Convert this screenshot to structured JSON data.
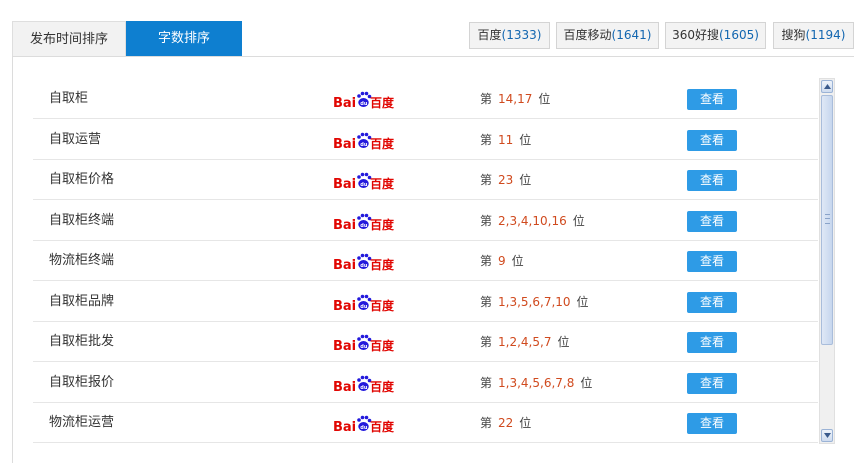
{
  "tabs": {
    "time": "发布时间排序",
    "count": "字数排序"
  },
  "engines": [
    {
      "name": "百度",
      "count": "(1333)"
    },
    {
      "name": "百度移动",
      "count": "(1641)"
    },
    {
      "name": "360好搜",
      "count": "(1605)"
    },
    {
      "name": "搜狗",
      "count": "(1194)"
    }
  ],
  "row_labels": {
    "prefix": "第",
    "suffix": "位",
    "view_button": "查看",
    "engine_logo_text": "Bai",
    "engine_logo_cn": "百度"
  },
  "rows": [
    {
      "keyword": "自取柜",
      "rank": "14,17"
    },
    {
      "keyword": "自取运营",
      "rank": "11"
    },
    {
      "keyword": "自取柜价格",
      "rank": "23"
    },
    {
      "keyword": "自取柜终端",
      "rank": "2,3,4,10,16"
    },
    {
      "keyword": "物流柜终端",
      "rank": "9"
    },
    {
      "keyword": "自取柜品牌",
      "rank": "1,3,5,6,7,10"
    },
    {
      "keyword": "自取柜批发",
      "rank": "1,2,4,5,7"
    },
    {
      "keyword": "自取柜报价",
      "rank": "1,3,4,5,6,7,8"
    },
    {
      "keyword": "物流柜运营",
      "rank": "22"
    }
  ],
  "colors": {
    "active_tab": "#0e7fd0",
    "view_button": "#2e9be6",
    "rank_number": "#d04a1e",
    "logo_red": "#e10602",
    "logo_blue": "#2319dc"
  }
}
